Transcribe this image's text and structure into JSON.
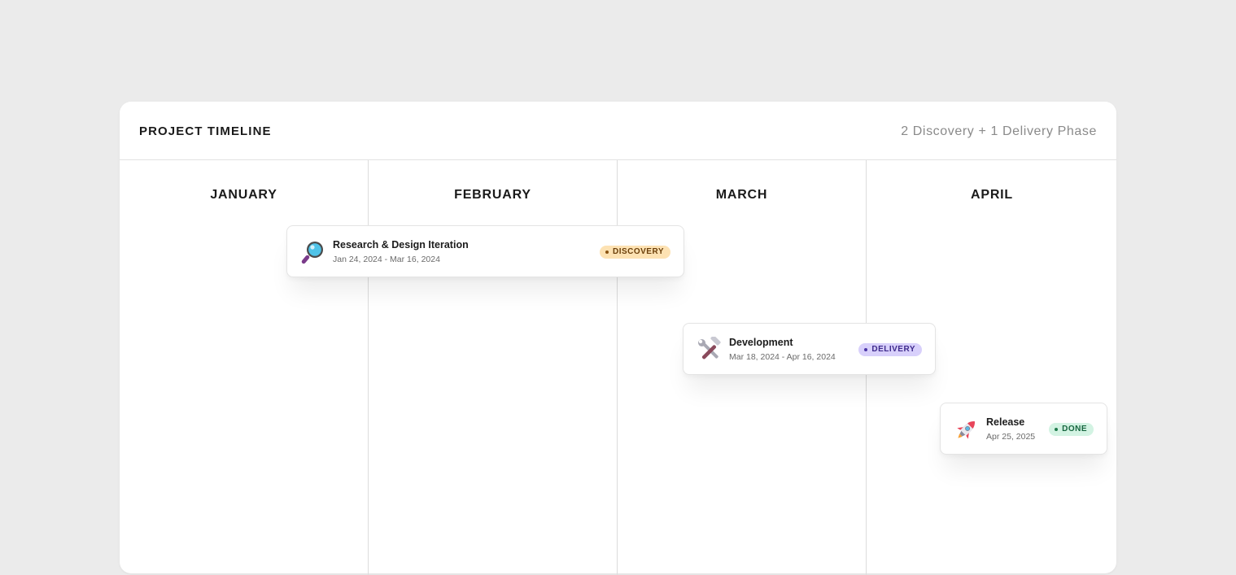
{
  "header": {
    "title": "PROJECT TIMELINE",
    "subtitle": "2 Discovery + 1 Delivery Phase"
  },
  "months": [
    "JANUARY",
    "FEBRUARY",
    "MARCH",
    "APRIL"
  ],
  "events": [
    {
      "name": "Research & Design Iteration",
      "dates": "Jan 24, 2024 - Mar 16, 2024",
      "badge": "DISCOVERY",
      "icon": "magnifying-glass-icon"
    },
    {
      "name": "Development",
      "dates": "Mar 18, 2024 - Apr 16, 2024",
      "badge": "DELIVERY",
      "icon": "hammer-and-wrench-icon"
    },
    {
      "name": "Release",
      "dates": "Apr 25, 2025",
      "badge": "DONE",
      "icon": "rocket-icon"
    }
  ],
  "colors": {
    "background": "#ebebeb",
    "card": "#ffffff",
    "discovery_badge": "#fde2b3",
    "delivery_badge": "#d8d0fb",
    "done_badge": "#d3f3e3"
  }
}
